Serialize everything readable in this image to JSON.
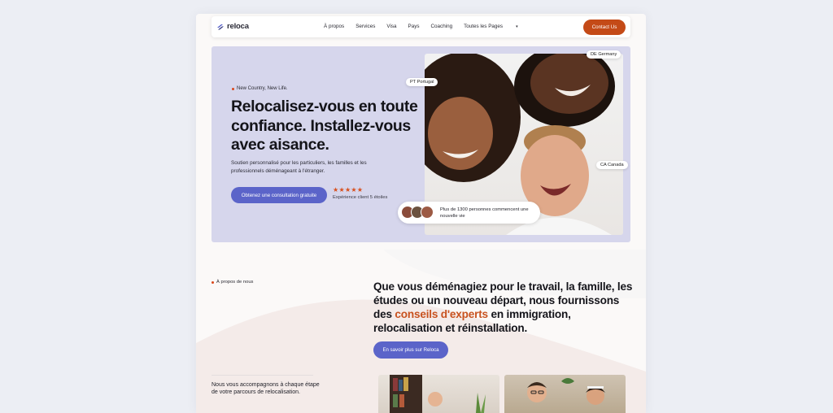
{
  "brand": {
    "name": "reloca",
    "accent_color": "#c44a17",
    "primary_color": "#5b64c9",
    "hero_bg": "#d6d6ec"
  },
  "nav": {
    "items": [
      "À propos",
      "Services",
      "Visa",
      "Pays",
      "Coaching",
      "Toutes les Pages"
    ],
    "contact_label": "Contact Us"
  },
  "hero": {
    "tagline": "New Country, New Life.",
    "title": "Relocalisez-vous en toute confiance. Installez-vous avec aisance.",
    "subtitle": "Soutien personnalisé pour les particuliers, les familles et les professionnels déménageant à l'étranger.",
    "cta_label": "Obtenez une consultation gratuite",
    "stars": "★★★★★",
    "rating_text": "Expérience client 5 étoiles",
    "flags": {
      "portugal": "PT Portugal",
      "germany": "DE Germany",
      "canada": "CA Canada"
    },
    "social_proof": "Plus de 1300 personnes commencent une nouvelle vie"
  },
  "about": {
    "label": "À propos de nous",
    "statement_before": "Que vous déménagiez pour le travail, la famille, les études ou un nouveau départ, nous fournissons des ",
    "statement_accent": "conseils d'experts",
    "statement_after": " en immigration, relocalisation et réinstallation.",
    "button_label": "En savoir plus sur Reloca",
    "steps_text": "Nous vous accompagnons à chaque étape de votre parcours de relocalisation."
  }
}
